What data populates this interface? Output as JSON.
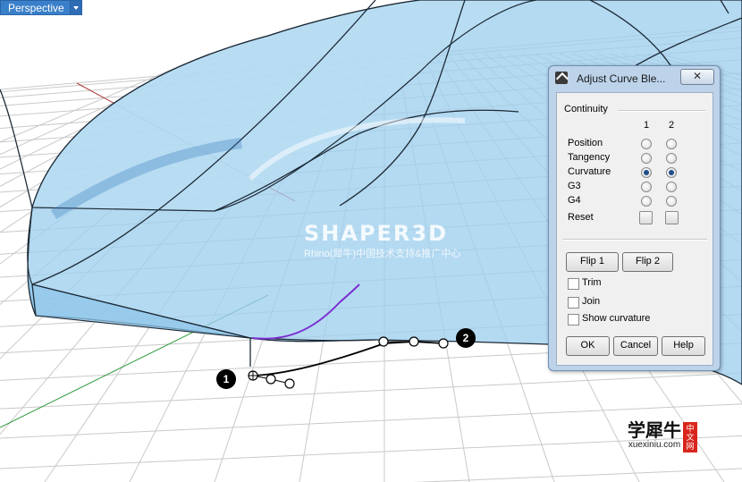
{
  "viewport": {
    "label": "Perspective",
    "watermark_brand": "SHAPER3D",
    "watermark_sub": "Rhino(犀牛)中国技术支持&推广中心",
    "point_labels": [
      "1",
      "2"
    ]
  },
  "logo": {
    "text": "学犀牛",
    "url": "xuexiniu.com",
    "badge": "中文网"
  },
  "dialog": {
    "title": "Adjust Curve Ble...",
    "close_label": "✕",
    "continuity": {
      "label": "Continuity",
      "col1": "1",
      "col2": "2",
      "rows": [
        {
          "label": "Position",
          "side1": false,
          "side2": false
        },
        {
          "label": "Tangency",
          "side1": false,
          "side2": false
        },
        {
          "label": "Curvature",
          "side1": true,
          "side2": true
        },
        {
          "label": "G3",
          "side1": false,
          "side2": false
        },
        {
          "label": "G4",
          "side1": false,
          "side2": false
        }
      ],
      "reset_label": "Reset"
    },
    "flip1_label": "Flip 1",
    "flip2_label": "Flip 2",
    "trim_label": "Trim",
    "join_label": "Join",
    "show_curvature_label": "Show curvature",
    "ok_label": "OK",
    "cancel_label": "Cancel",
    "help_label": "Help"
  },
  "colors": {
    "surface": "#9fd0ee",
    "tab_bg": "#3a7fc9",
    "blend_curve": "#7a2fd0"
  }
}
